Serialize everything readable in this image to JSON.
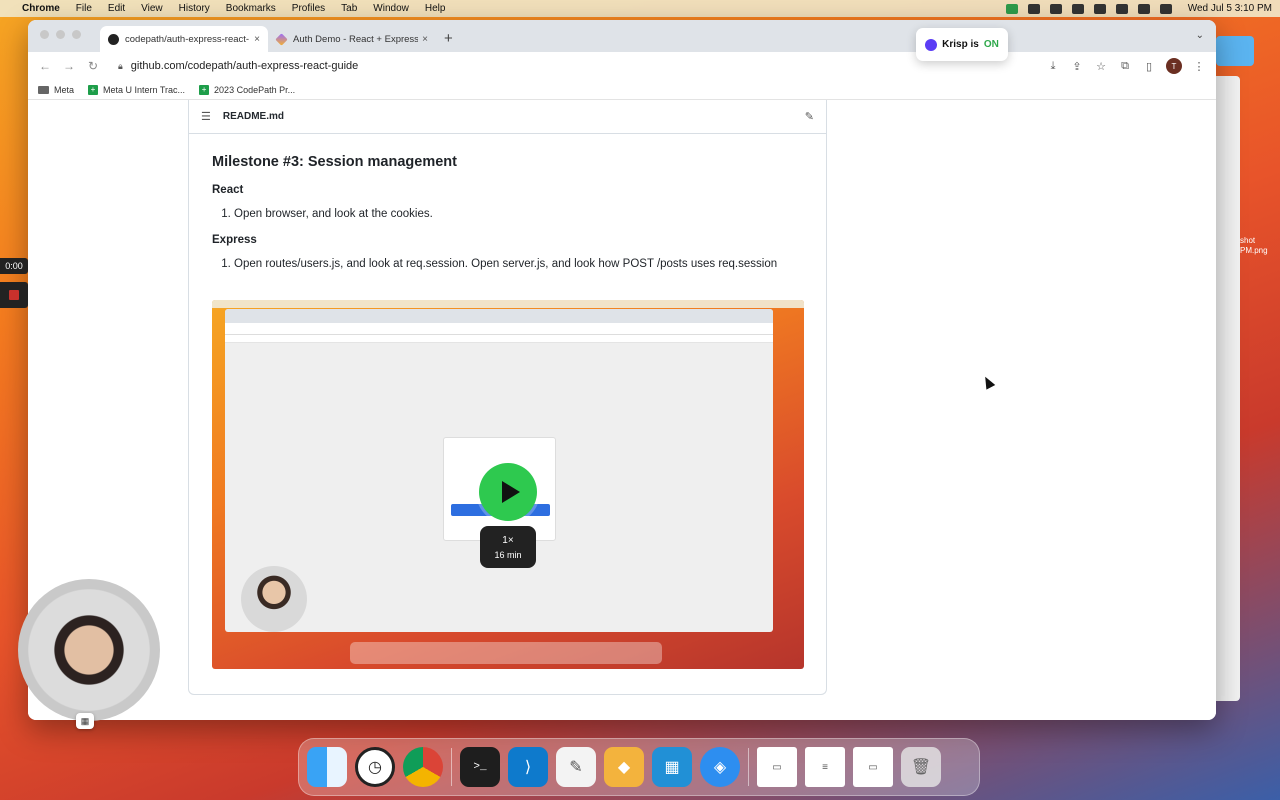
{
  "menubar": {
    "app_name": "Chrome",
    "menus": [
      "File",
      "Edit",
      "View",
      "History",
      "Bookmarks",
      "Profiles",
      "Tab",
      "Window",
      "Help"
    ],
    "clock": "Wed Jul 5  3:10 PM"
  },
  "browser": {
    "tabs": [
      {
        "title": "codepath/auth-express-react-",
        "close": "×"
      },
      {
        "title": "Auth Demo - React + Express",
        "close": "×"
      }
    ],
    "new_tab": "+",
    "url": "github.com/codepath/auth-express-react-guide",
    "profile_initial": "T",
    "bookmarks": [
      "Meta",
      "Meta U Intern Trac...",
      "2023 CodePath Pr..."
    ]
  },
  "readme": {
    "filename": "README.md",
    "heading": "Milestone #3: Session management",
    "sections": [
      {
        "title": "React",
        "items": [
          "Open browser, and look at the cookies."
        ]
      },
      {
        "title": "Express",
        "items": [
          "Open routes/users.js, and look at req.session. Open server.js, and look how POST /posts uses req.session"
        ]
      }
    ]
  },
  "video": {
    "speed": "1×",
    "duration": "16 min"
  },
  "krisp": {
    "label": "Krisp is",
    "state": "ON"
  },
  "recorder": {
    "timer": "0:00"
  },
  "side_file": {
    "line1": "shot",
    "line2": "PM.png"
  }
}
